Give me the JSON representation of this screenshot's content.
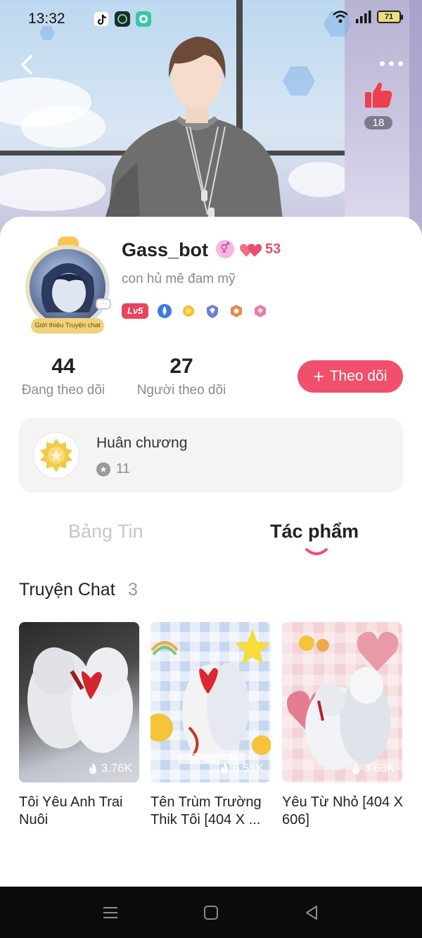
{
  "status_bar": {
    "time": "13:32",
    "battery": "71",
    "app_icons": [
      "tiktok-icon",
      "app-icon",
      "chat-app-icon"
    ]
  },
  "header": {
    "like_count": "18"
  },
  "profile": {
    "name": "Gass_bot",
    "bio": "con hủ mê đam mỹ",
    "heart_value": "53",
    "level": "Lv5",
    "avatar_tag": "Giới thiệu Truyện chat",
    "gender_symbol": "⚥"
  },
  "stats": {
    "following_count": "44",
    "following_label": "Đang theo dõi",
    "followers_count": "27",
    "followers_label": "Người theo dõi",
    "follow_button": "Theo dõi"
  },
  "medals": {
    "title": "Huân chương",
    "count": "11"
  },
  "tabs": [
    {
      "label": "Bảng Tin",
      "active": false
    },
    {
      "label": "Tác phẩm",
      "active": true
    }
  ],
  "section": {
    "title": "Truyện Chat",
    "count": "3"
  },
  "stories": [
    {
      "title": "Tôi Yêu Anh Trai Nuôi",
      "views": "3.76K"
    },
    {
      "title": "Tên Trùm Trường Thik Tôi [404 X ...",
      "views": "6.51K"
    },
    {
      "title": "Yêu Từ Nhỏ [404 X 606]",
      "views": "3.63K"
    }
  ],
  "colors": {
    "accent": "#f0506c",
    "heart": "#e0506c",
    "level_badge": "#e8445e",
    "inactive_tab": "#c6c6c6",
    "medal_bg": "#f4f4f4"
  }
}
